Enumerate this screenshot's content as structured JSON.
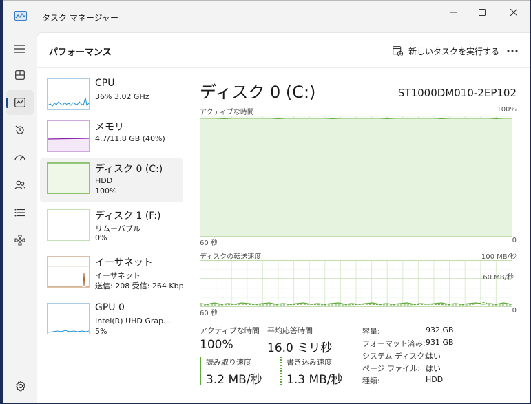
{
  "window": {
    "title": "タスク マネージャー"
  },
  "header": {
    "title": "パフォーマンス",
    "run_new_task": "新しいタスクを実行する"
  },
  "colors": {
    "accent": "#1a4a8c",
    "cpu": "#1b8fd6",
    "memory": "#8b22a8",
    "disk": "#5ea83a",
    "ethernet": "#a8622a",
    "gpu": "#1b8fd6"
  },
  "nav": [
    {
      "icon": "hamburger-icon"
    },
    {
      "icon": "processes-icon"
    },
    {
      "icon": "performance-icon"
    },
    {
      "icon": "app-history-icon"
    },
    {
      "icon": "startup-icon"
    },
    {
      "icon": "users-icon"
    },
    {
      "icon": "details-icon"
    },
    {
      "icon": "services-icon"
    },
    {
      "icon": "settings-icon"
    }
  ],
  "devices": [
    {
      "name": "CPU",
      "sub1": "36%  3.02 GHz",
      "sub2": "",
      "sub3": ""
    },
    {
      "name": "メモリ",
      "sub1": "4.7/11.8 GB (40%)",
      "sub2": "",
      "sub3": ""
    },
    {
      "name": "ディスク 0 (C:)",
      "sub1": "HDD",
      "sub2": "100%",
      "sub3": ""
    },
    {
      "name": "ディスク 1 (F:)",
      "sub1": "リムーバブル",
      "sub2": "0%",
      "sub3": ""
    },
    {
      "name": "イーサネット",
      "sub1": "イーサネット",
      "sub2": "送信: 208  受信: 264 Kbp",
      "sub3": ""
    },
    {
      "name": "GPU 0",
      "sub1": "Intel(R) UHD Grap...",
      "sub2": "5%",
      "sub3": ""
    }
  ],
  "detail": {
    "title": "ディスク 0 (C:)",
    "model": "ST1000DM010-2EP102",
    "graph1": {
      "label": "アクティブな時間",
      "max": "100%",
      "time": "60 秒",
      "min": "0",
      "level": 0.99
    },
    "graph2": {
      "label": "ディスクの転送速度",
      "max": "100 MB/秒",
      "ref": "60 MB/秒",
      "time": "60 秒",
      "min": "0"
    },
    "stats": {
      "active_label": "アクティブな時間",
      "active_value": "100%",
      "resp_label": "平均応答時間",
      "resp_value": "16.0 ミリ秒",
      "read_label": "読み取り速度",
      "read_value": "3.2 MB/秒",
      "write_label": "書き込み速度",
      "write_value": "1.3 MB/秒"
    },
    "props": [
      {
        "k": "容量:",
        "v": "932 GB"
      },
      {
        "k": "フォーマット済み:",
        "v": "931 GB"
      },
      {
        "k": "システム ディスク:",
        "v": "はい"
      },
      {
        "k": "ページ ファイル:",
        "v": "はい"
      },
      {
        "k": "種類:",
        "v": "HDD"
      }
    ]
  }
}
